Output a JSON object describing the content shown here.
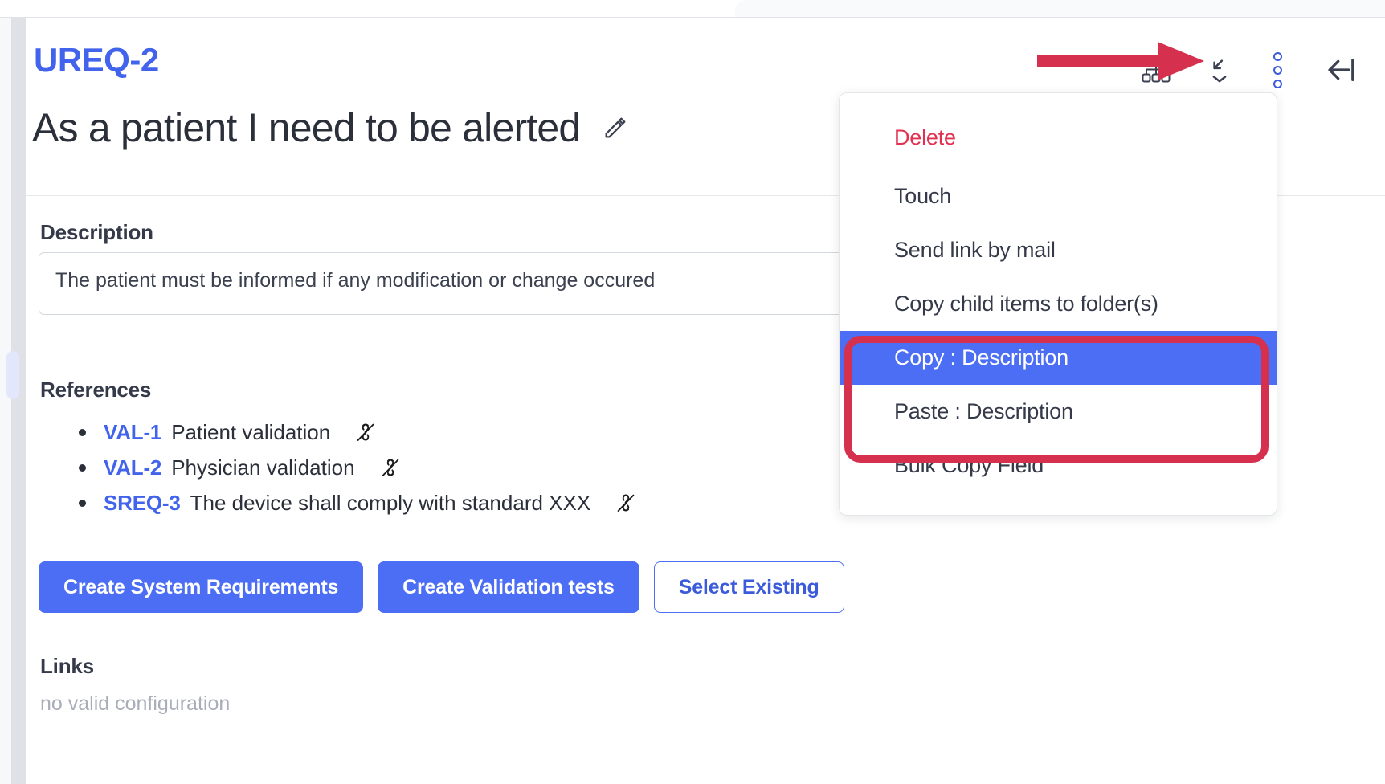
{
  "header": {
    "requirement_id": "UREQ-2",
    "title": "As a patient I need to be alerted",
    "edit_icon": "pencil-icon",
    "actions": [
      {
        "name": "hierarchy-icon",
        "label": "Hierarchy"
      },
      {
        "name": "collapse-arrow-icon",
        "label": "Collapse"
      },
      {
        "name": "more-options-icon",
        "label": "More options"
      },
      {
        "name": "close-panel-icon",
        "label": "Close panel"
      }
    ]
  },
  "description": {
    "label": "Description",
    "value": "The patient must be informed if any modification or change occured",
    "placeholder": "Description"
  },
  "references": {
    "label": "References",
    "items": [
      {
        "key": "VAL-1",
        "title": "Patient validation",
        "unlink_icon": "unlink-icon"
      },
      {
        "key": "VAL-2",
        "title": "Physician validation",
        "unlink_icon": "unlink-icon"
      },
      {
        "key": "SREQ-3",
        "title": "The device shall comply with standard XXX",
        "unlink_icon": "unlink-icon"
      }
    ]
  },
  "actions": {
    "create_system_requirements": "Create System Requirements",
    "create_validation_tests": "Create Validation tests",
    "select_existing": "Select Existing"
  },
  "links": {
    "label": "Links",
    "empty_text": "no valid configuration"
  },
  "context_menu": {
    "items": [
      {
        "label": "Delete",
        "state": "danger"
      },
      {
        "label": "Touch",
        "state": "normal"
      },
      {
        "label": "Send link by mail",
        "state": "normal"
      },
      {
        "label": "Copy child items to folder(s)",
        "state": "normal"
      },
      {
        "label": "Copy : Description",
        "state": "active"
      },
      {
        "label": "Paste : Description",
        "state": "normal"
      },
      {
        "label": "Bulk Copy Field",
        "state": "normal"
      }
    ]
  },
  "annotations": {
    "arrow_color": "#d6304f",
    "box_color": "#d6304f"
  },
  "colors": {
    "accent_blue": "#4c6ef5",
    "link_blue": "#4263eb",
    "danger_red": "#e03250",
    "text_dark": "#2b2f3a",
    "muted": "#a9adb8"
  }
}
